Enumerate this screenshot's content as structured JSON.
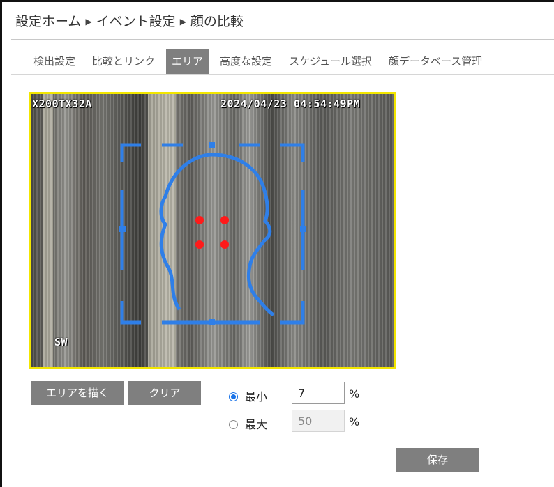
{
  "breadcrumb": {
    "items": [
      "設定ホーム",
      "イベント設定",
      "顔の比較"
    ],
    "separator": "▶"
  },
  "tabs": [
    {
      "label": "検出設定",
      "active": false
    },
    {
      "label": "比較とリンク",
      "active": false
    },
    {
      "label": "エリア",
      "active": true
    },
    {
      "label": "高度な設定",
      "active": false
    },
    {
      "label": "スケジュール選択",
      "active": false
    },
    {
      "label": "顔データベース管理",
      "active": false
    }
  ],
  "video": {
    "osd_left": "X200TX32A",
    "osd_right": "2024/04/23 04:54:49PM",
    "osd_bottom": "SW",
    "border_color": "#f2e600",
    "overlay_color": "#2f7fe8",
    "marker_color": "#ff1a1a"
  },
  "controls": {
    "draw_area_label": "エリアを描く",
    "clear_label": "クリア",
    "min_label": "最小",
    "min_value": "7",
    "max_label": "最大",
    "max_value": "50",
    "unit": "%",
    "selected": "min",
    "save_label": "保存"
  }
}
